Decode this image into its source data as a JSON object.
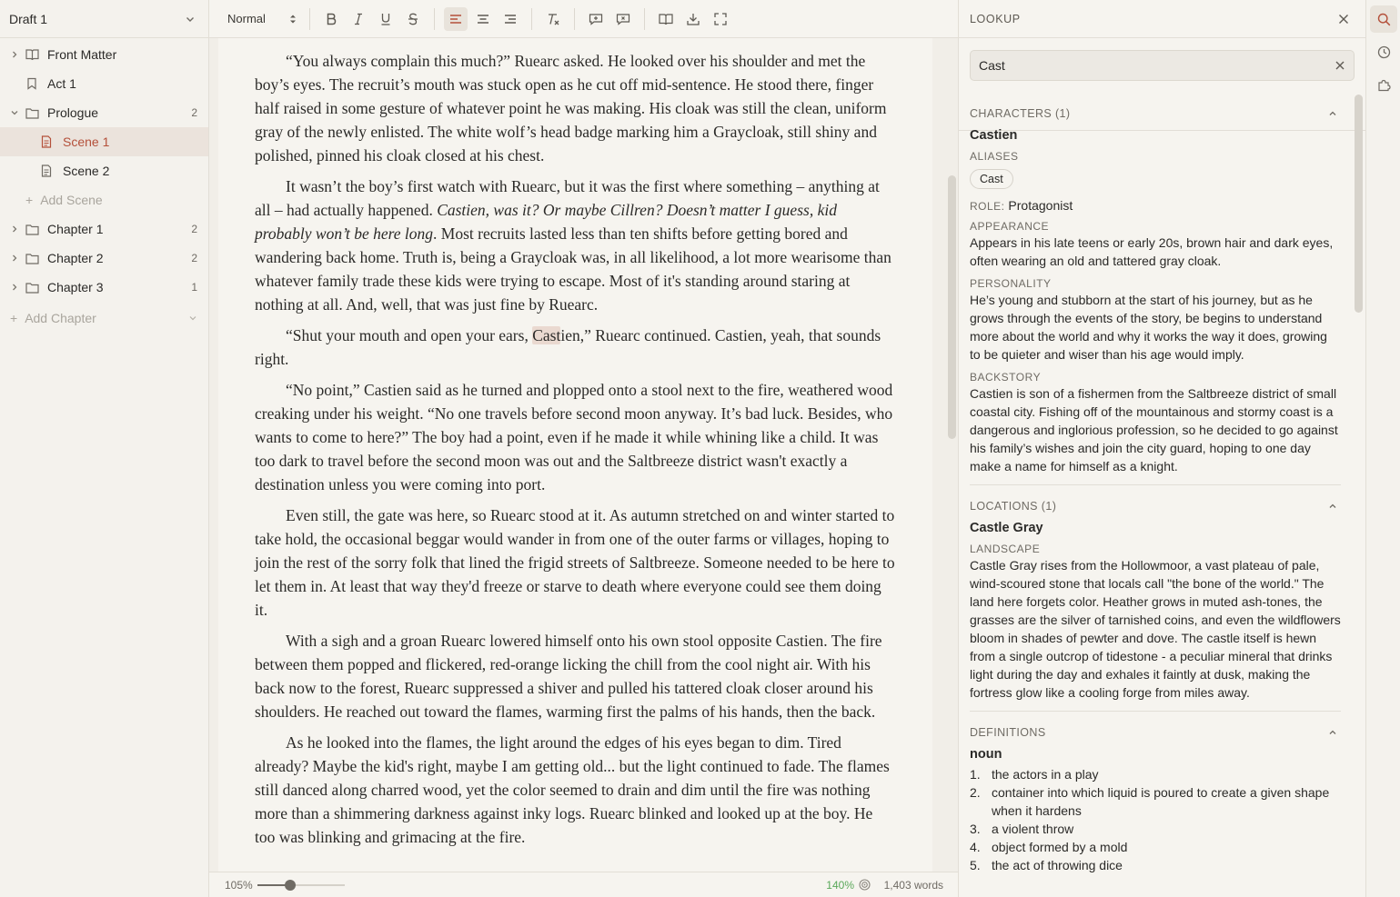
{
  "sidebar": {
    "draft_title": "Draft 1",
    "tree": [
      {
        "label": "Front Matter",
        "count": ""
      },
      {
        "label": "Act 1",
        "count": ""
      },
      {
        "label": "Prologue",
        "count": "2"
      },
      {
        "label": "Scene 1",
        "count": ""
      },
      {
        "label": "Scene 2",
        "count": ""
      },
      {
        "label": "Add Scene",
        "count": ""
      },
      {
        "label": "Chapter 1",
        "count": "2"
      },
      {
        "label": "Chapter 2",
        "count": "2"
      },
      {
        "label": "Chapter 3",
        "count": "1"
      },
      {
        "label": "Add Chapter",
        "count": ""
      }
    ]
  },
  "toolbar": {
    "style_value": "Normal"
  },
  "editor": {
    "highlight": "Cast",
    "paragraphs": [
      {
        "text": "“You always complain this much?” Ruearc asked. He looked over his shoulder and met the boy’s eyes. The recruit’s mouth was stuck open as he cut off mid-sentence. He stood there, finger half raised in some gesture of whatever point he was making. His cloak was still the clean, uniform gray of the newly enlisted. The white wolf’s head badge marking him a Graycloak, still shiny and polished, pinned his cloak closed at his chest."
      },
      {
        "pre": "It wasn’t the boy’s first watch with Ruearc, but it was the first where something – anything at all – had actually happened. ",
        "em": "Castien, was it? Or maybe Cillren? Doesn’t matter I guess, kid probably won’t be here long",
        "post": ". Most recruits lasted less than ten shifts before getting bored and wandering back home. Truth is, being a Graycloak was, in all likelihood, a lot more wearisome than whatever family trade these kids were trying to escape. Most of it's standing around staring at nothing at all. And, well, that was just fine by Ruearc."
      },
      {
        "pre": "“Shut your mouth and open your ears, ",
        "hl": "Cast",
        "post": "ien,” Ruearc continued. Castien, yeah, that sounds right."
      },
      {
        "text": "“No point,” Castien said as he turned and plopped onto a stool next to the fire, weathered wood creaking under his weight. “No one travels before second moon anyway. It’s bad luck. Besides, who wants to come to here?” The boy had a point, even if he made it while whining like a child. It was too dark to travel before the second moon was out and the Saltbreeze district wasn't exactly a destination unless you were coming into port."
      },
      {
        "text": "Even still, the gate was here, so Ruearc stood at it. As autumn stretched on and winter started to take hold, the occasional beggar would wander in from one of the outer farms or villages, hoping to join the rest of the sorry folk that lined the frigid streets of Saltbreeze. Someone needed to be here to let them in. At least that way they'd freeze or starve to death where everyone could see them doing it."
      },
      {
        "text": "With a sigh and a groan Ruearc lowered himself onto his own stool opposite Castien. The fire between them popped and flickered, red-orange licking the chill from the cool night air. With his back now to the forest, Ruearc suppressed a shiver and pulled his tattered cloak closer around his shoulders. He reached out toward the flames, warming first the palms of his hands, then the back."
      },
      {
        "text": "As he looked into the flames, the light around the edges of his eyes began to dim. Tired already? Maybe the kid's right, maybe I am getting old... but the light continued to fade. The flames still danced along charred wood, yet the color seemed to drain and dim until the fire was nothing more than a shimmering darkness against inky logs. Ruearc blinked and looked up at the boy. He too was blinking and grimacing at the fire."
      }
    ]
  },
  "status": {
    "zoom": "105%",
    "zoom_fraction": 0.38,
    "goal_pct": "140%",
    "words": "1,403 words"
  },
  "lookup": {
    "title": "LOOKUP",
    "search_value": "Cast",
    "characters": {
      "heading": "CHARACTERS (1)",
      "name": "Castien",
      "aliases_label": "ALIASES",
      "alias": "Cast",
      "role_label": "ROLE:",
      "role": "Protagonist",
      "appearance_label": "APPEARANCE",
      "appearance": "Appears in his late teens or early 20s, brown hair and dark eyes, often wearing an old and tattered gray cloak.",
      "personality_label": "PERSONALITY",
      "personality": "He’s young and stubborn at the start of his journey, but as he grows through the events of the story, be begins to understand more about the world and why it works the way it does, growing to be quieter and wiser than his age would imply.",
      "backstory_label": "BACKSTORY",
      "backstory": "Castien is son of a fishermen from the Saltbreeze district of small coastal city. Fishing off of the mountainous and stormy coast is a dangerous and inglorious profession, so he decided to go against his family’s wishes and join the city guard, hoping to one day make a name for himself as a knight."
    },
    "locations": {
      "heading": "LOCATIONS (1)",
      "name": "Castle Gray",
      "landscape_label": "LANDSCAPE",
      "landscape": "Castle Gray rises from the Hollowmoor, a vast plateau of pale, wind-scoured stone that locals call \"the bone of the world.\" The land here forgets color. Heather grows in muted ash-tones, the grasses are the silver of tarnished coins, and even the wildflowers bloom in shades of pewter and dove. The castle itself is hewn from a single outcrop of tidestone - a peculiar mineral that drinks light during the day and exhales it faintly at dusk, making the fortress glow like a cooling forge from miles away."
    },
    "definitions": {
      "heading": "DEFINITIONS",
      "pos": "noun",
      "items": [
        {
          "num": "1.",
          "text": "the actors in a play"
        },
        {
          "num": "2.",
          "text": "container into which liquid is poured to create a given shape when it hardens"
        },
        {
          "num": "3.",
          "text": "a violent throw"
        },
        {
          "num": "4.",
          "text": "object formed by a mold"
        },
        {
          "num": "5.",
          "text": "the act of throwing dice"
        }
      ]
    }
  }
}
